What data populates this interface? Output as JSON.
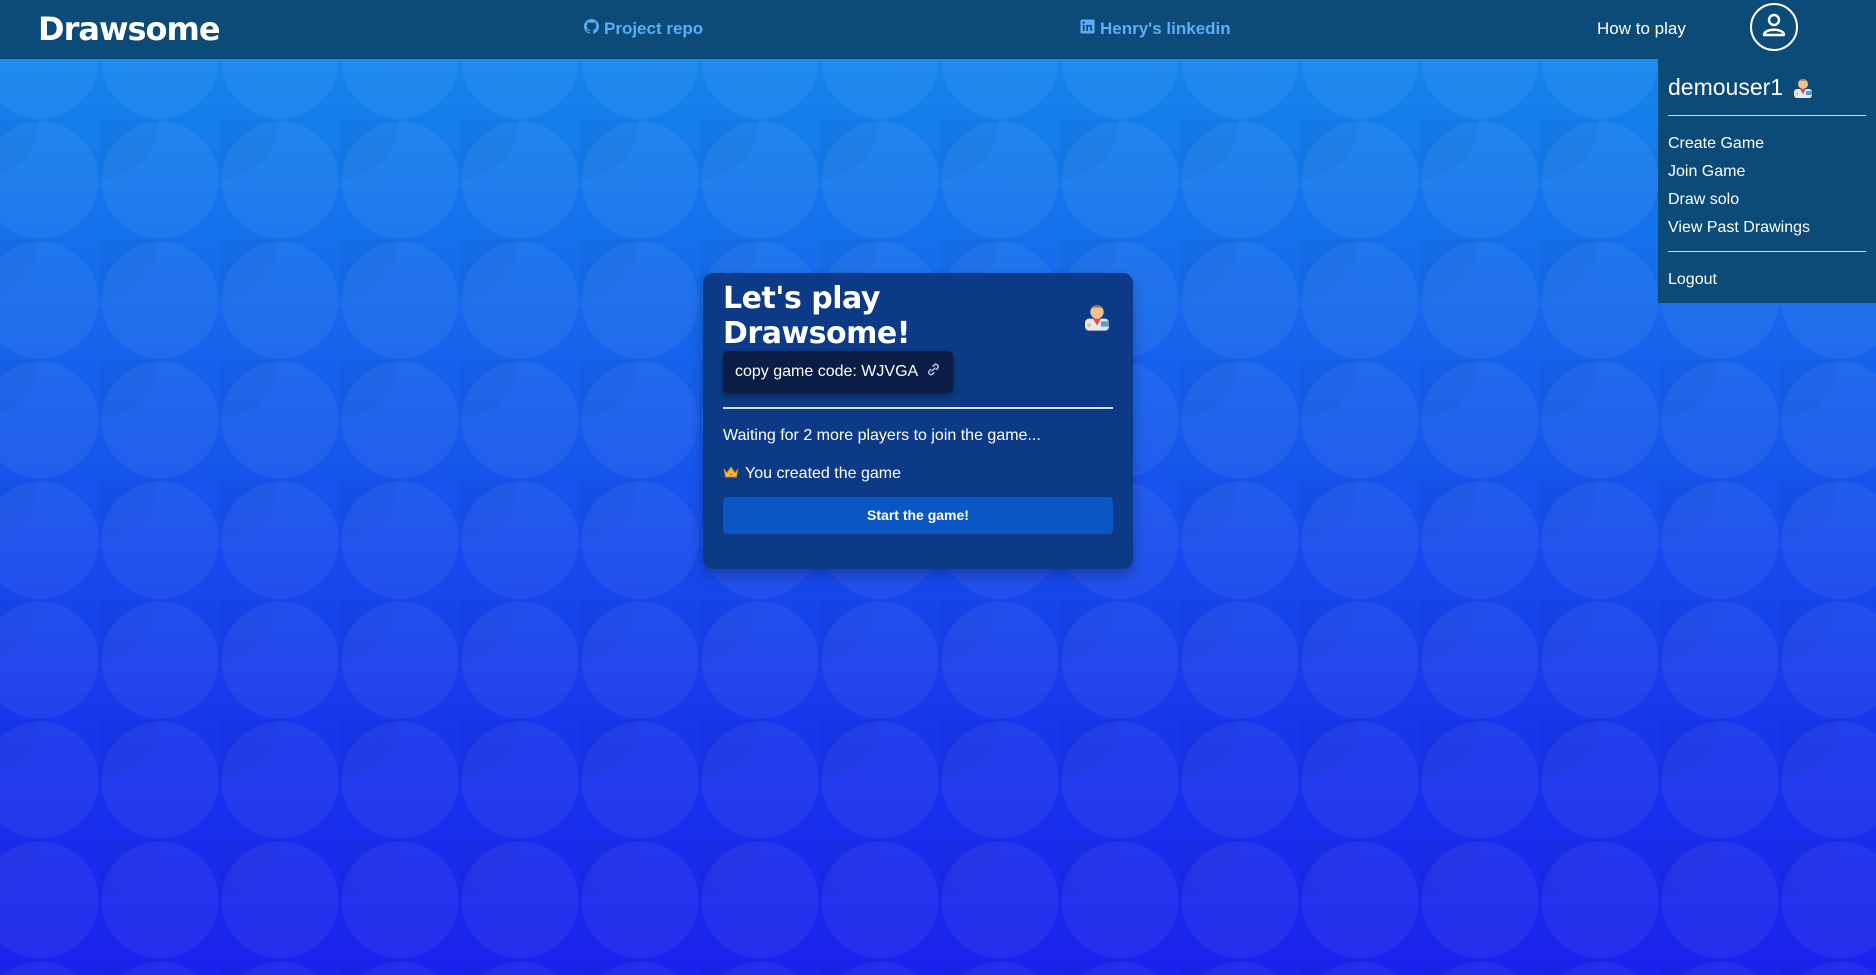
{
  "app": {
    "brand": "Drawsome"
  },
  "nav": {
    "repo_label": "Project repo",
    "linkedin_label": "Henry's linkedin",
    "how_to_label": "How to play"
  },
  "dropdown": {
    "username": "demouser1",
    "items": [
      "Create Game",
      "Join Game",
      "Draw solo",
      "View Past Drawings"
    ],
    "logout_label": "Logout"
  },
  "card": {
    "title": "Let's play Drawsome!",
    "copy_code_label": "copy game code: WJVGA",
    "waiting_text": "Waiting for 2 more players to join the game...",
    "creator_text": "You created the game",
    "start_label": "Start the game!"
  },
  "icons": {
    "repo": "github-icon",
    "linkedin": "linkedin-icon",
    "profile": "user-circle-icon",
    "link": "link-icon",
    "crown": "crown-icon",
    "avatar": "artist-emoji-icon"
  },
  "colors": {
    "navbar": "#0c4a78",
    "link": "#5aaef7",
    "card": "#0d3a86",
    "code_button": "#0b1d45",
    "start_button": "#0a56c2"
  }
}
